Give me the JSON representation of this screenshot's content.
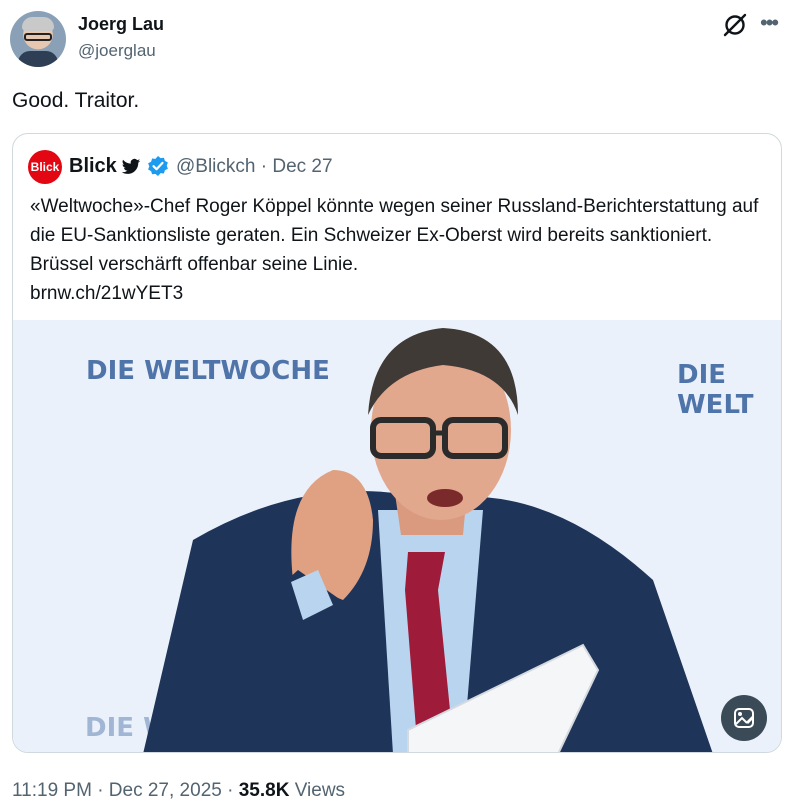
{
  "tweet": {
    "author_name": "Joerg Lau",
    "author_handle": "@joerglau",
    "text": "Good. Traitor.",
    "more_label": "•••"
  },
  "quote": {
    "avatar_text": "Blick",
    "name": "Blick",
    "handle": "@Blickch · Dec 27",
    "text": "«Weltwoche»-Chef Roger Köppel könnte wegen seiner Russland-Berichterstattung auf die EU-Sanktionsliste geraten. Ein Schweizer Ex-Oberst wird bereits sanktioniert. Brüssel verschärft offenbar seine Linie.",
    "link": "brnw.ch/21wYET3",
    "photo": {
      "brand_text_1": "DIE WELTWOCHE",
      "brand_text_2": "DIE WELT",
      "brand_text_3": "DIE WELTWO"
    }
  },
  "footer": {
    "time": "11:19 PM · Dec 27, 2025 · ",
    "views_count": "35.8K",
    "views_label": "Views"
  },
  "colors": {
    "verified": "#1d9bf0",
    "blick_red": "#e30613",
    "secondary_text": "#536471",
    "border": "#cfd9de"
  }
}
